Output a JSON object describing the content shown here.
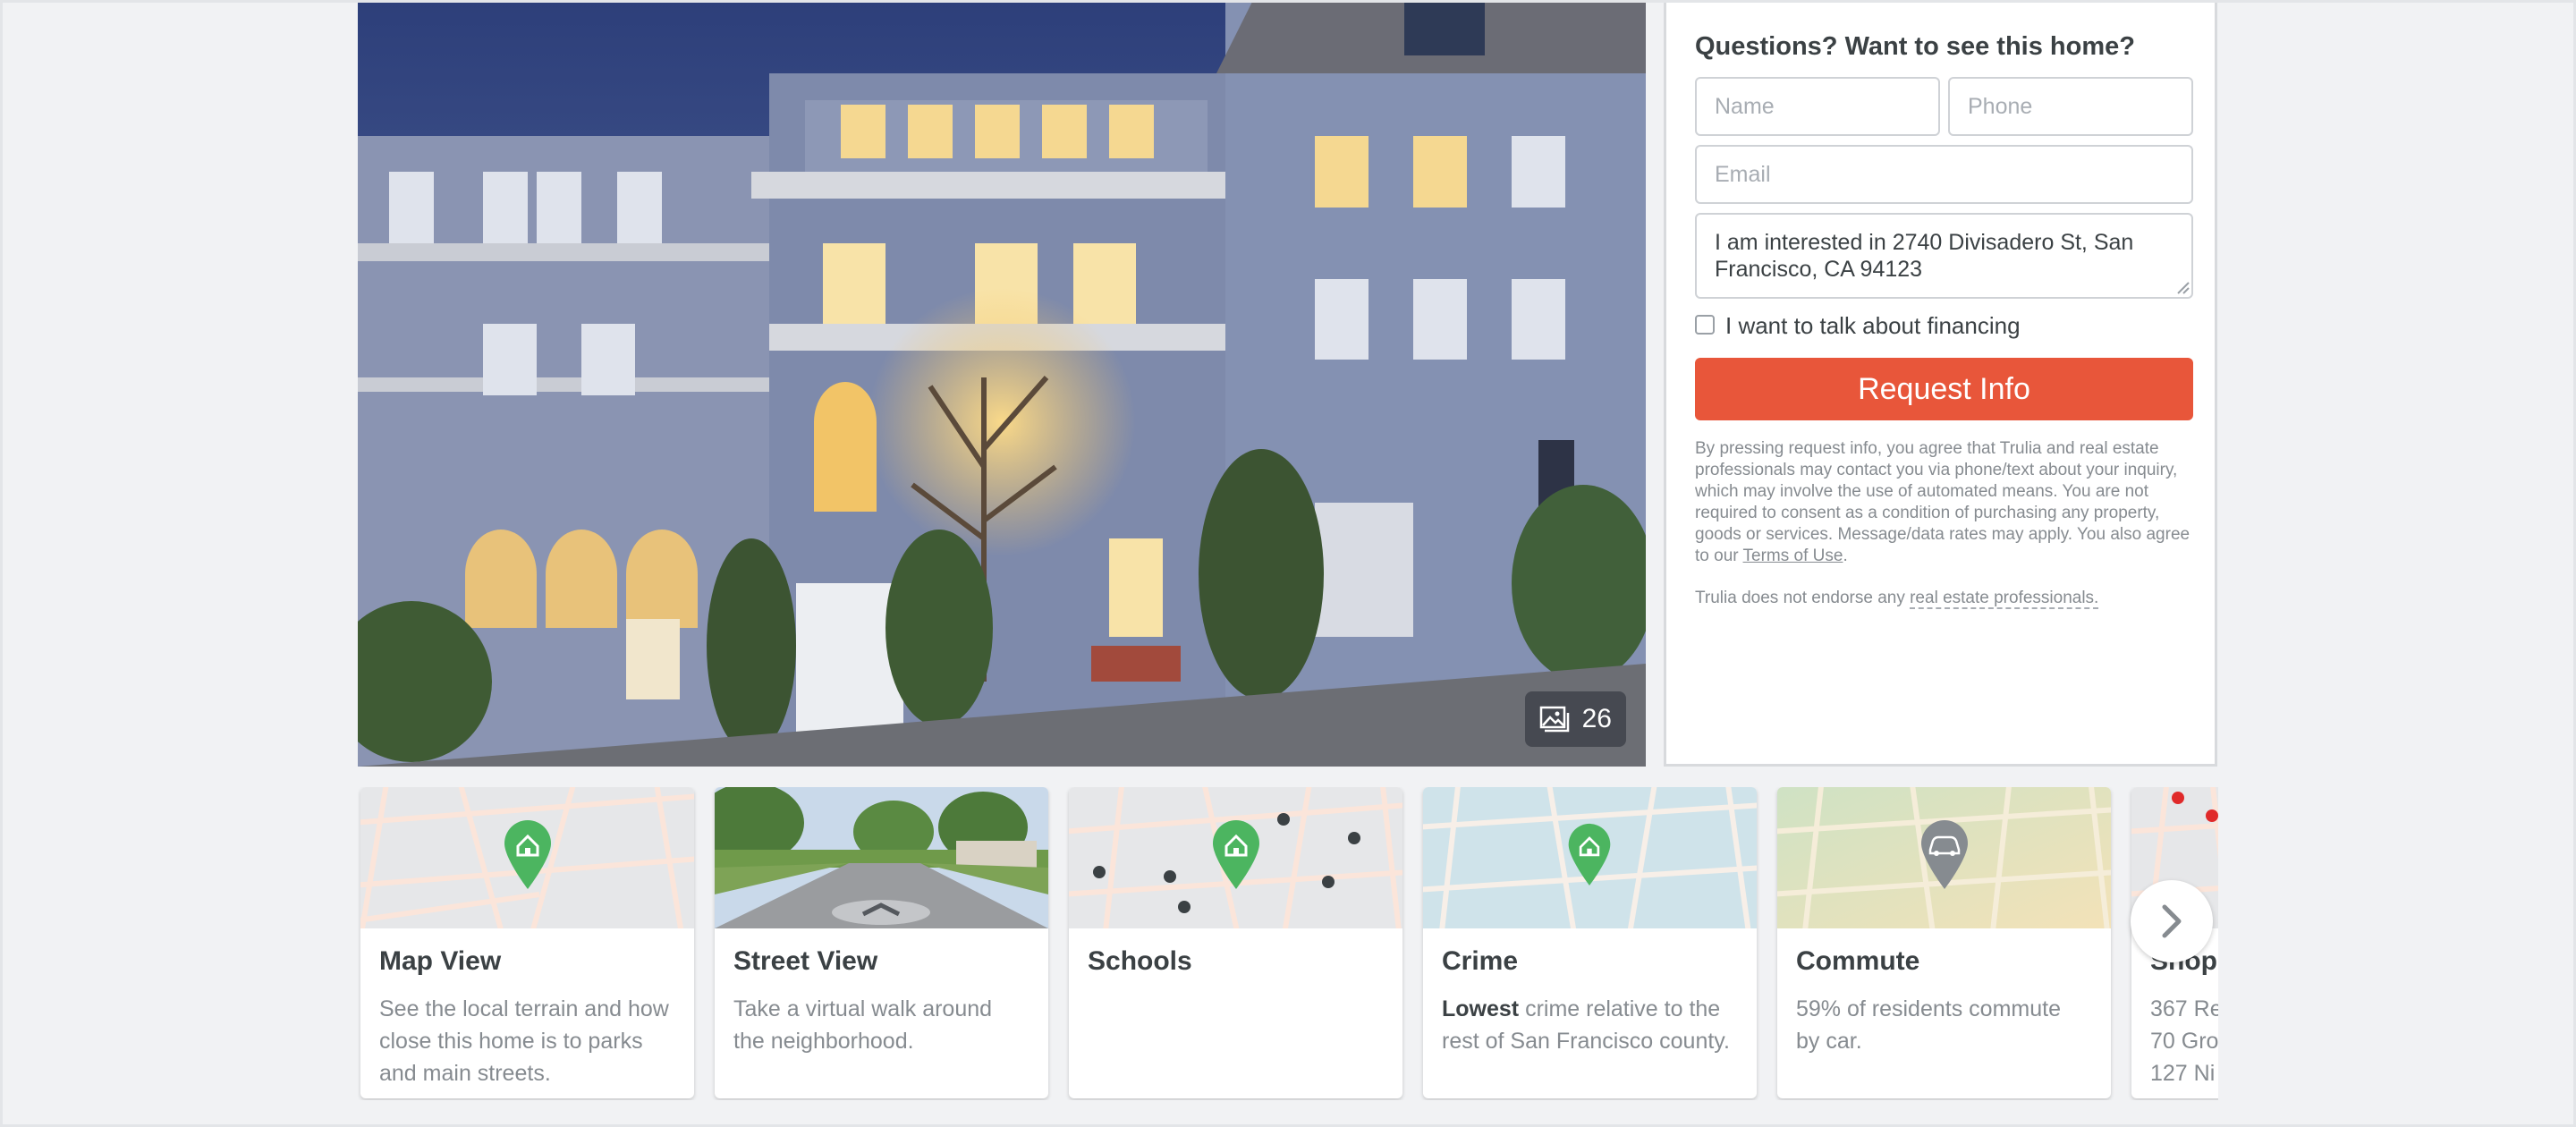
{
  "photo": {
    "photo_count": "26",
    "icons": {
      "gallery": "image-gallery-icon"
    }
  },
  "lead_form": {
    "title": "Questions? Want to see this home?",
    "name_placeholder": "Name",
    "phone_placeholder": "Phone",
    "email_placeholder": "Email",
    "message": "I am interested in 2740 Divisadero St, San Francisco, CA 94123",
    "financing_label": "I want to talk about financing",
    "financing_checked": false,
    "submit_label": "Request Info",
    "disclaimer_text": "By pressing request info, you agree that Trulia and real estate professionals may contact you via phone/text about your inquiry, which may involve the use of automated means. You are not required to consent as a condition of purchasing any property, goods or services. Message/data rates may apply. You also agree to our ",
    "terms_link": "Terms of Use",
    "disclaimer_end": ".",
    "endorse_text": "Trulia does not endorse any ",
    "endorse_link": "real estate professionals."
  },
  "cards": [
    {
      "title": "Map View",
      "description": "See the local terrain and how\nclose this home is to parks\nand main streets."
    },
    {
      "title": "Street View",
      "description": "Take a virtual walk around\nthe neighborhood."
    },
    {
      "title": "Schools",
      "description": ""
    },
    {
      "title": "Crime",
      "description_bold": "Lowest",
      "description": " crime relative to the\nrest of San Francisco county."
    },
    {
      "title": "Commute",
      "description": "59% of residents commute\nby car."
    },
    {
      "title": "Shop",
      "description": "367 Re\n70 Gro\n127 Ni"
    }
  ],
  "carousel": {
    "next_icon": "chevron-right-icon"
  },
  "colors": {
    "accent": "#e8563a",
    "pin_green": "#4cb560",
    "pin_gray": "#868b90",
    "text": "#3b4144",
    "muted": "#868b90"
  }
}
